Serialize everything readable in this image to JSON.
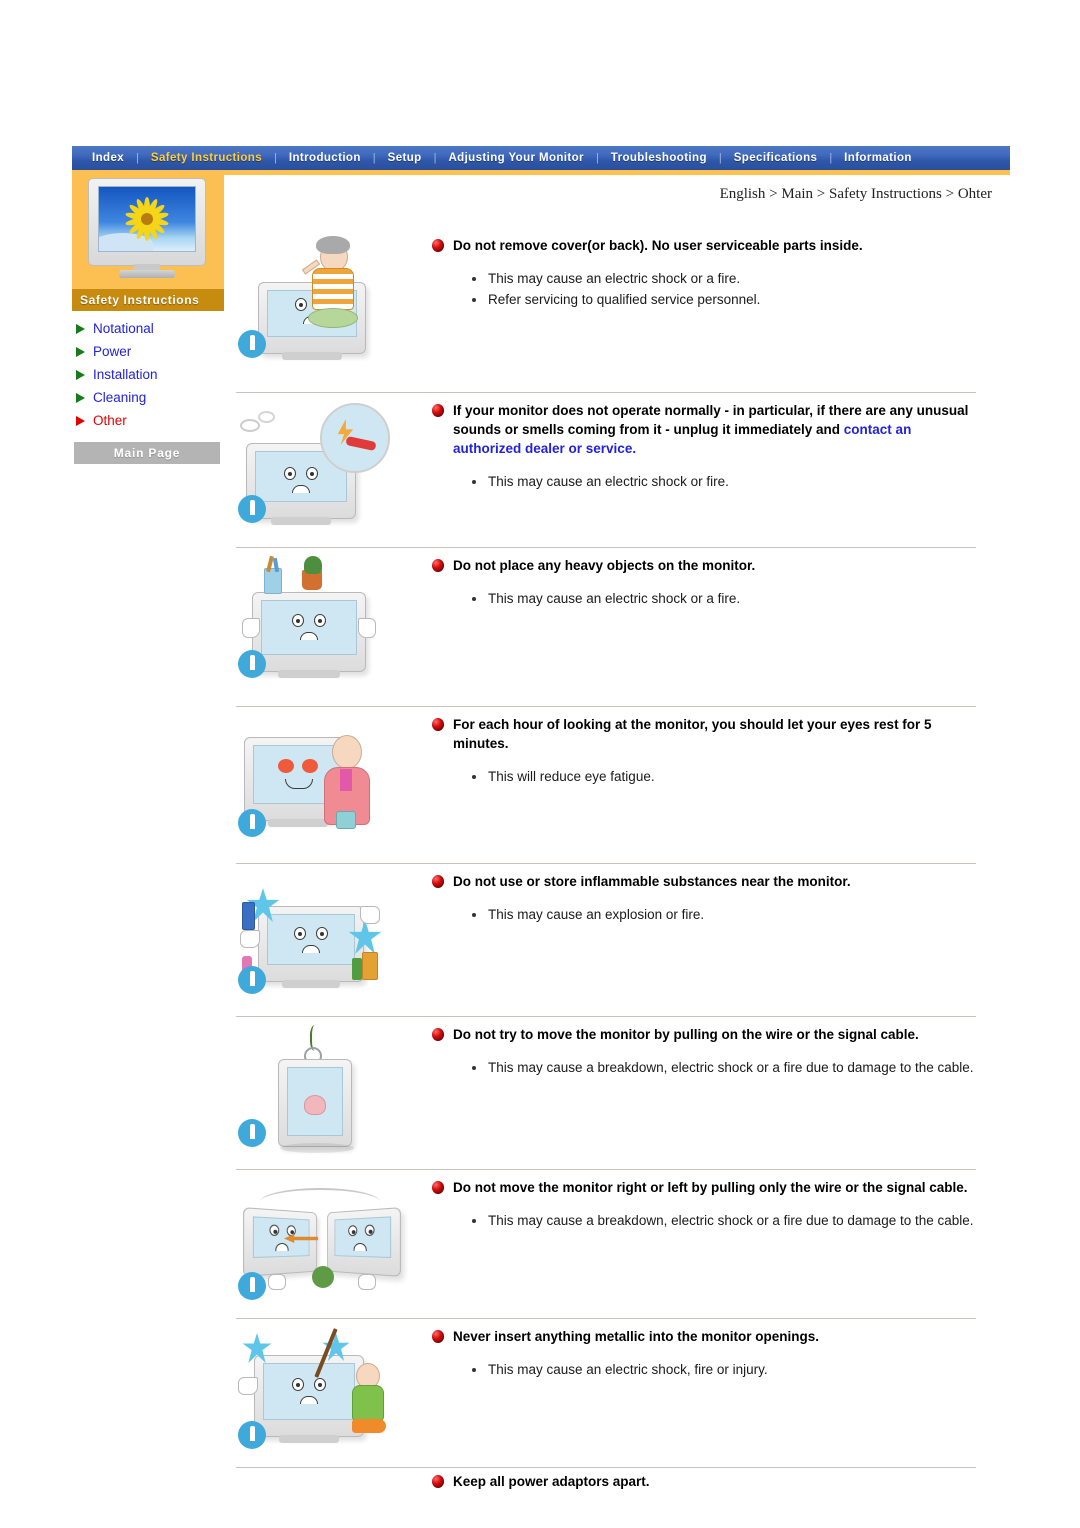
{
  "nav": {
    "items": [
      {
        "label": "Index",
        "active": false
      },
      {
        "label": "Safety Instructions",
        "active": true
      },
      {
        "label": "Introduction",
        "active": false
      },
      {
        "label": "Setup",
        "active": false
      },
      {
        "label": "Adjusting Your Monitor",
        "active": false
      },
      {
        "label": "Troubleshooting",
        "active": false
      },
      {
        "label": "Specifications",
        "active": false
      },
      {
        "label": "Information",
        "active": false
      }
    ],
    "separator": "|",
    "accent_color": "#ffcf33",
    "bar_color": "#2f56a8",
    "underline_color": "#ffc14d"
  },
  "sidebar": {
    "banner_label": "Safety Instructions",
    "banner_color": "#fbbf52",
    "banner_label_color": "#c78b10",
    "banner_icon": "crt-monitor-sunflower-image",
    "links": [
      {
        "label": "Notational",
        "active": false
      },
      {
        "label": "Power",
        "active": false
      },
      {
        "label": "Installation",
        "active": false
      },
      {
        "label": "Cleaning",
        "active": false
      },
      {
        "label": "Other",
        "active": true
      }
    ],
    "main_page_button": "Main Page",
    "link_color": "#2222dd",
    "active_link_color": "#e50000",
    "arrow_color": "#167c1b",
    "active_arrow_color": "#e50000"
  },
  "breadcrumb": "English > Main > Safety Instructions > Ohter",
  "sections": [
    {
      "heading": "Do not remove cover(or back). No user serviceable parts inside.",
      "link_text": "",
      "bullets": [
        "This may cause an electric shock or a fire.",
        "Refer servicing to qualified service personnel."
      ],
      "art": "technician-opening-monitor-illustration"
    },
    {
      "heading": "If your monitor does not operate normally - in particular, if there are any unusual sounds or smells coming from it - unplug it immediately and ",
      "link_text": "contact an authorized dealer or service.",
      "bullets": [
        "This may cause an electric shock or fire."
      ],
      "art": "smoking-monitor-unplug-illustration"
    },
    {
      "heading": "Do not place any heavy objects on the monitor.",
      "link_text": "",
      "bullets": [
        "This may cause an electric shock or a fire."
      ],
      "art": "heavy-objects-on-monitor-illustration"
    },
    {
      "heading": "For each hour of looking at the monitor, you should let your eyes rest for 5 minutes.",
      "link_text": "",
      "bullets": [
        "This will reduce eye fatigue."
      ],
      "art": "woman-resting-eyes-illustration"
    },
    {
      "heading": "Do not use or store inflammable substances near the monitor.",
      "link_text": "",
      "bullets": [
        "This may cause an explosion or fire."
      ],
      "art": "inflammable-substances-illustration"
    },
    {
      "heading": "Do not try to move the monitor by pulling on the wire or the signal cable.",
      "link_text": "",
      "bullets": [
        "This may cause a breakdown, electric shock or a fire due to damage to the cable."
      ],
      "art": "monitor-hanging-by-cable-illustration"
    },
    {
      "heading": "Do not move the monitor right or left by pulling only the wire or the signal cable.",
      "link_text": "",
      "bullets": [
        "This may cause a breakdown, electric shock or a fire due to damage to the cable."
      ],
      "art": "monitor-dragged-sideways-illustration"
    },
    {
      "heading": "Never insert anything metallic into the monitor openings.",
      "link_text": "",
      "bullets": [
        "This may cause an electric shock, fire or injury."
      ],
      "art": "metal-object-in-monitor-illustration"
    },
    {
      "heading": "Keep all power adaptors apart.",
      "link_text": "",
      "bullets": [],
      "art": ""
    }
  ]
}
